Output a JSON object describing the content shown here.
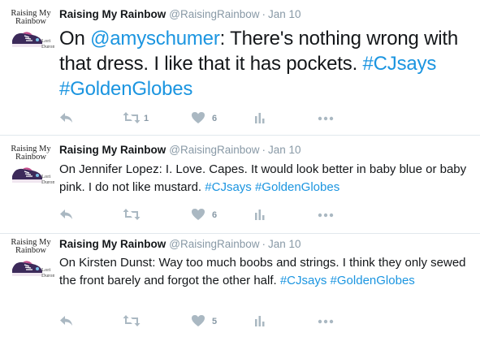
{
  "account": {
    "name": "Raising My Rainbow",
    "handle": "@RaisingRainbow",
    "avatar_title": "Raising My Rainbow",
    "avatar_author": "Lori Duron"
  },
  "tweets": [
    {
      "time": "Jan 10",
      "text_before": "On ",
      "mention": "@amyschumer",
      "text_after": ": There's nothing wrong with that dress. I like that it has pockets. ",
      "hashtag1": "#CJsays",
      "hashtag2": "#GoldenGlobes",
      "retweets": "1",
      "likes": "6"
    },
    {
      "time": "Jan 10",
      "text": "On Jennifer Lopez: I. Love. Capes. It would look better in baby blue or baby pink. I do not like mustard. ",
      "hashtag1": "#CJsays",
      "hashtag2": "#GoldenGlobes",
      "likes": "6"
    },
    {
      "time": "Jan 10",
      "text": "On Kirsten Dunst: Way too much boobs and strings. I think they only sewed the front barely and forgot the other half. ",
      "hashtag1": "#CJsays",
      "hashtag2": "#GoldenGlobes",
      "likes": "5"
    }
  ],
  "icons": {
    "reply": "reply-icon",
    "retweet": "retweet-icon",
    "like": "heart-icon",
    "stats": "analytics-icon",
    "more": "more-icon"
  },
  "colors": {
    "link": "#1b95e0",
    "muted": "#8899a6",
    "icon": "#aab8c2",
    "divider": "#e1e8ed"
  }
}
